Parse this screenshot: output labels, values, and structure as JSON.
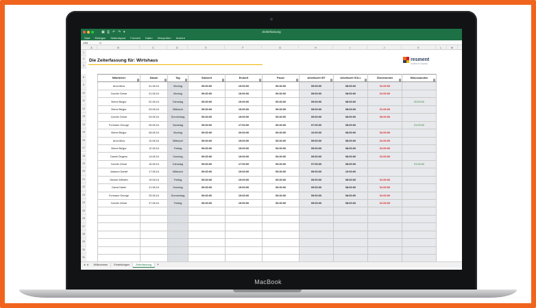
{
  "device": {
    "brand": "MacBook"
  },
  "window": {
    "title": "Zeiterfassung"
  },
  "ribbon": {
    "tabs": [
      "Start",
      "Einfügen",
      "Seitenlayout",
      "Formeln",
      "Daten",
      "Überprüfen",
      "Ansicht"
    ]
  },
  "formula_bar": {
    "cell_ref": "U54",
    "fx": "fx"
  },
  "columns": [
    "A",
    "B",
    "C",
    "D",
    "E",
    "F",
    "G",
    "H",
    "I",
    "J",
    "K",
    "L",
    "M"
  ],
  "row_numbers": [
    "1",
    "2",
    "3",
    "8",
    "9",
    "10",
    "11",
    "12",
    "13",
    "14",
    "15",
    "16",
    "17",
    "18",
    "19",
    "20",
    "21",
    "22",
    "23",
    "24",
    "25",
    "26",
    "27",
    "28",
    "29",
    "30",
    "31"
  ],
  "sheet": {
    "title": "Die Zeiterfassung für: Wirtshaus",
    "logo": "resment",
    "logo_sub": "simplified for hospitality"
  },
  "table": {
    "headers": [
      "Mitarbeiter",
      "Datum",
      "Tag",
      "Startzeit",
      "Endzeit",
      "Pause",
      "Arbeitszeit IST",
      "Arbeitszeit SOLL",
      "Überstunden",
      "Minusstunden"
    ],
    "rows": [
      {
        "mitarbeiter": "Arnd Ahus",
        "datum": "01.08.16",
        "tag": "Montag",
        "start": "09:30:00",
        "ende": "19:00:00",
        "pause": "00:30:00",
        "ist": "09:00:00",
        "soll": "08:00:00",
        "ueber": "01:00:00",
        "minus": ""
      },
      {
        "mitarbeiter": "Carolin Clewe",
        "datum": "01.08.16",
        "tag": "Montag",
        "start": "09:30:00",
        "ende": "19:00:00",
        "pause": "00:30:00",
        "ist": "09:00:00",
        "soll": "08:00:00",
        "ueber": "01:00:00",
        "minus": ""
      },
      {
        "mitarbeiter": "Bernd Bulgur",
        "datum": "02.08.16",
        "tag": "Dienstag",
        "start": "09:30:00",
        "ende": "19:00:00",
        "pause": "00:30:00",
        "ist": "09:00:00",
        "soll": "08:00:00",
        "ueber": "",
        "minus": "00:00:00"
      },
      {
        "mitarbeiter": "Bernd Bulgur",
        "datum": "03.08.16",
        "tag": "Mittwoch",
        "start": "09:30:00",
        "ende": "19:00:00",
        "pause": "00:30:00",
        "ist": "09:00:00",
        "soll": "08:00:00",
        "ueber": "01:00:00",
        "minus": ""
      },
      {
        "mitarbeiter": "Carolin Clewe",
        "datum": "04.08.16",
        "tag": "Donnerstag",
        "start": "09:30:00",
        "ende": "19:00:00",
        "pause": "00:30:00",
        "ist": "09:00:00",
        "soll": "08:00:00",
        "ueber": "00:00:00",
        "minus": ""
      },
      {
        "mitarbeiter": "Formann George",
        "datum": "06.08.16",
        "tag": "Samstag",
        "start": "09:30:00",
        "ende": "17:00:00",
        "pause": "00:30:00",
        "ist": "07:00:00",
        "soll": "08:00:00",
        "ueber": "",
        "minus": "01:00:00"
      },
      {
        "mitarbeiter": "Bernd Bulgur",
        "datum": "08.08.16",
        "tag": "Montag",
        "start": "09:30:00",
        "ende": "20:00:00",
        "pause": "00:30:00",
        "ist": "10:00:00",
        "soll": "08:00:00",
        "ueber": "02:00:00",
        "minus": ""
      },
      {
        "mitarbeiter": "Arnd Ahus",
        "datum": "10.08.16",
        "tag": "Mittwoch",
        "start": "09:30:00",
        "ende": "19:00:00",
        "pause": "00:30:00",
        "ist": "09:00:00",
        "soll": "08:00:00",
        "ueber": "01:00:00",
        "minus": ""
      },
      {
        "mitarbeiter": "Bernd Bulgur",
        "datum": "12.08.16",
        "tag": "Freitag",
        "start": "09:30:00",
        "ende": "19:00:00",
        "pause": "00:30:00",
        "ist": "09:00:00",
        "soll": "08:00:00",
        "ueber": "01:00:00",
        "minus": ""
      },
      {
        "mitarbeiter": "Daniel Dirgens",
        "datum": "14.08.16",
        "tag": "Sonntag",
        "start": "09:30:00",
        "ende": "19:00:00",
        "pause": "00:30:00",
        "ist": "09:00:00",
        "soll": "08:00:00",
        "ueber": "01:00:00",
        "minus": ""
      },
      {
        "mitarbeiter": "Carolin Clewe",
        "datum": "16.08.16",
        "tag": "Dienstag",
        "start": "09:30:00",
        "ende": "17:00:00",
        "pause": "00:30:00",
        "ist": "07:00:00",
        "soll": "08:00:00",
        "ueber": "",
        "minus": "01:00:00"
      },
      {
        "mitarbeiter": "Jackson Daniel",
        "datum": "17.08.16",
        "tag": "Mittwoch",
        "start": "09:30:00",
        "ende": "19:00:00",
        "pause": "00:30:00",
        "ist": "09:00:00",
        "soll": "10:00:00",
        "ueber": "",
        "minus": ""
      },
      {
        "mitarbeiter": "Denise Wilhelm",
        "datum": "19.08.16",
        "tag": "Freitag",
        "start": "09:30:00",
        "ende": "19:00:00",
        "pause": "00:30:00",
        "ist": "09:00:00",
        "soll": "08:00:00",
        "ueber": "01:00:00",
        "minus": ""
      },
      {
        "mitarbeiter": "David Habel",
        "datum": "21.08.16",
        "tag": "Sonntag",
        "start": "09:30:00",
        "ende": "19:00:00",
        "pause": "00:30:00",
        "ist": "09:00:00",
        "soll": "08:00:00",
        "ueber": "01:00:00",
        "minus": ""
      },
      {
        "mitarbeiter": "Formann George",
        "datum": "25.08.16",
        "tag": "Donnerstag",
        "start": "09:30:00",
        "ende": "19:00:00",
        "pause": "00:30:00",
        "ist": "09:00:00",
        "soll": "08:00:00",
        "ueber": "01:00:00",
        "minus": ""
      },
      {
        "mitarbeiter": "Carolin Clewe",
        "datum": "27.08.16",
        "tag": "Freitag",
        "start": "09:30:00",
        "ende": "19:00:00",
        "pause": "00:30:00",
        "ist": "09:00:00",
        "soll": "08:00:00",
        "ueber": "01:00:00",
        "minus": ""
      }
    ],
    "empty_rows": 7
  },
  "sheet_tabs": [
    {
      "label": "Willkommen",
      "active": false
    },
    {
      "label": "Einstellungen",
      "active": false
    },
    {
      "label": "Zeiterfassung",
      "active": true
    }
  ],
  "colors": {
    "excel_green": "#1e7145",
    "accent_orange": "#f0641e",
    "title_underline": "#f0b400",
    "overtime_red": "#d42020",
    "minus_green": "#2f7d2f"
  }
}
